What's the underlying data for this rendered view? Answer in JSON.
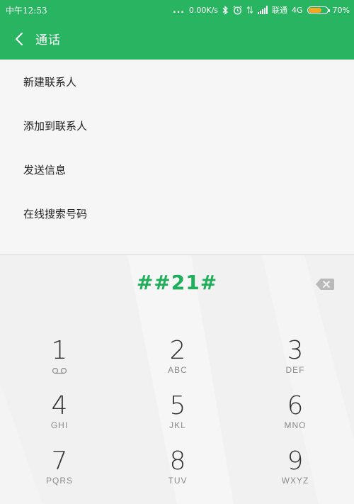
{
  "status_bar": {
    "time": "中午12:53",
    "dots": "...",
    "speed": "0.00K/s",
    "carrier": "联通",
    "network": "4G",
    "battery_percent": "70%",
    "battery_level": 0.7
  },
  "app_bar": {
    "title": "通话"
  },
  "options": [
    {
      "label": "新建联系人"
    },
    {
      "label": "添加到联系人"
    },
    {
      "label": "发送信息"
    },
    {
      "label": "在线搜索号码"
    }
  ],
  "dialer": {
    "number": "##21#",
    "keys": [
      {
        "digit": "1",
        "letters": ""
      },
      {
        "digit": "2",
        "letters": "ABC"
      },
      {
        "digit": "3",
        "letters": "DEF"
      },
      {
        "digit": "4",
        "letters": "GHI"
      },
      {
        "digit": "5",
        "letters": "JKL"
      },
      {
        "digit": "6",
        "letters": "MNO"
      },
      {
        "digit": "7",
        "letters": "PQRS"
      },
      {
        "digit": "8",
        "letters": "TUV"
      },
      {
        "digit": "9",
        "letters": "WXYZ"
      }
    ]
  },
  "colors": {
    "primary": "#28b460",
    "number_text": "#1fae5a",
    "battery": "#f7a823"
  },
  "icons": {
    "back": "chevron-left-icon",
    "backspace": "backspace-icon",
    "voicemail": "voicemail-icon",
    "bluetooth": "bluetooth-icon",
    "alarm": "alarm-icon",
    "data_transfer": "data-transfer-icon",
    "signal": "signal-icon",
    "battery": "battery-icon"
  }
}
